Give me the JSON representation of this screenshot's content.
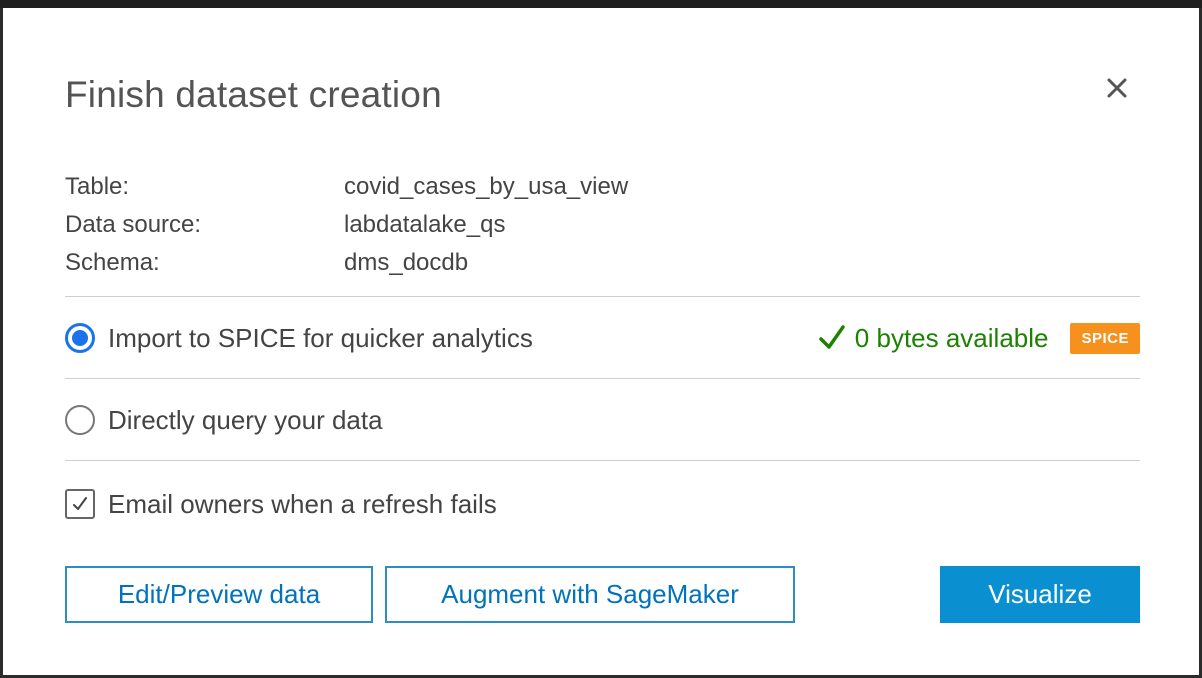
{
  "dialog": {
    "title": "Finish dataset creation",
    "close_icon": "close-icon"
  },
  "info": [
    {
      "label": "Table:",
      "value": "covid_cases_by_usa_view"
    },
    {
      "label": "Data source:",
      "value": "labdatalake_qs"
    },
    {
      "label": "Schema:",
      "value": "dms_docdb"
    }
  ],
  "options": {
    "spice": {
      "label": "Import to SPICE for quicker analytics",
      "selected": true
    },
    "spice_status": {
      "text": "0 bytes available",
      "icon": "check-icon",
      "color": "#1d8102"
    },
    "spice_badge": "SPICE",
    "direct": {
      "label": "Directly query your data",
      "selected": false
    },
    "email": {
      "label": "Email owners when a refresh fails",
      "checked": true
    }
  },
  "buttons": {
    "edit_preview": "Edit/Preview data",
    "sagemaker": "Augment with SageMaker",
    "visualize": "Visualize"
  },
  "colors": {
    "primary": "#0a8fd0",
    "radio_selected": "#1a73e8",
    "badge": "#f7911e"
  }
}
